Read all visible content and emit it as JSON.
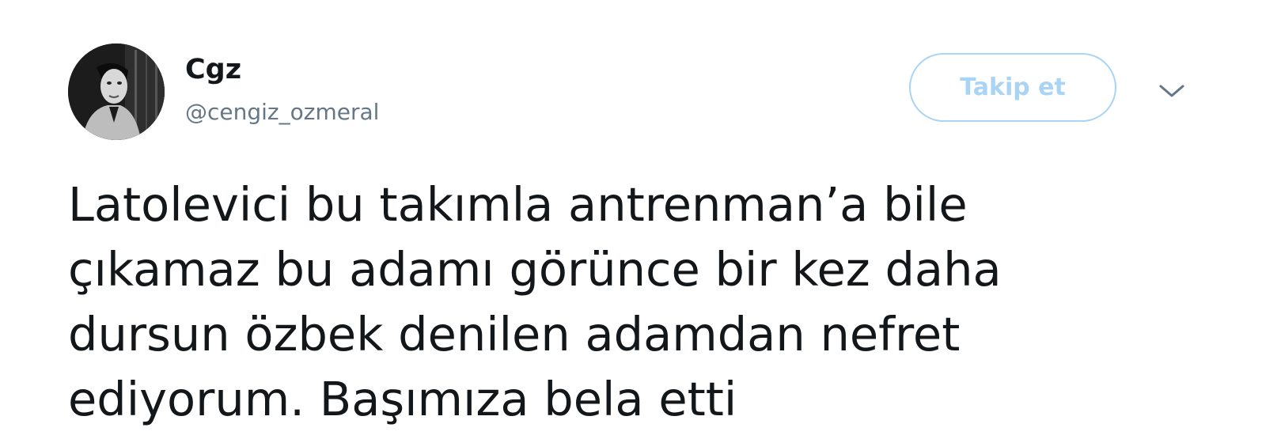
{
  "user": {
    "display_name": "Cgz",
    "handle": "@cengiz_ozmeral",
    "avatar_icon": "profile-photo"
  },
  "actions": {
    "follow_label": "Takip et",
    "menu_icon": "chevron-down-icon"
  },
  "tweet": {
    "lines": [
      "Latolevici bu takımla antrenman’a bile",
      "çıkamaz bu adamı görünce bir kez daha",
      "dursun özbek denilen adamdan nefret",
      "ediyorum. Başımıza bela etti"
    ]
  },
  "colors": {
    "text": "#14171a",
    "secondary_text": "#657786",
    "follow_accent": "#a9d4f5"
  }
}
